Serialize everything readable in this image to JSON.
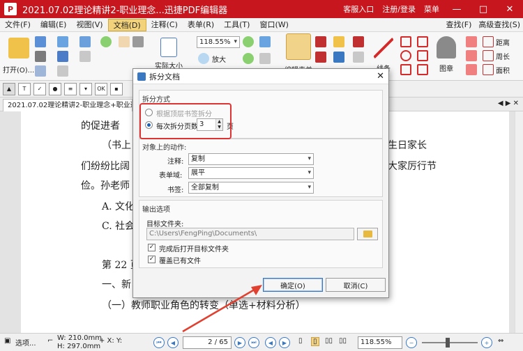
{
  "window": {
    "title": "2021.07.02理论精讲2-职业理念...迅捷PDF编辑器",
    "app_icon": "P",
    "right_items": [
      "客服入口",
      "注册/登录",
      "菜单"
    ],
    "controls": [
      "—",
      "□",
      "✕"
    ]
  },
  "menu": {
    "items": [
      "文件(F)",
      "编辑(E)",
      "视图(V)",
      "文档(D)",
      "注释(C)",
      "表单(R)",
      "工具(T)",
      "窗口(W)"
    ],
    "active_index": 3,
    "right": [
      "查找(F)",
      "高级查找(S)"
    ]
  },
  "ribbon": {
    "open_label": "打开(O)...",
    "zoom_value": "118.55%",
    "zoom_in_label": "放大",
    "actual_size_label": "实际大小",
    "edit_form_label": "编辑表单",
    "line_label": "线条",
    "stamp_label": "图章",
    "measure": [
      "距离",
      "周长",
      "面积"
    ]
  },
  "tab": {
    "title": "2021.07.02理论精讲2-职业理念+职业道德知..."
  },
  "document": {
    "lines": [
      "的促进者",
      "（书上",
      "生日家长",
      "们纷纷比阔",
      "大家厉行节",
      "俭。孙老师",
      "A. 文化",
      "C. 社会",
      "第 22 页",
      "一、新",
      "（一）教师职业角色的转变（单选+材料分析）"
    ]
  },
  "dialog": {
    "title": "拆分文档",
    "section_split": "拆分方式",
    "option_bookmark": "根据顶层书签拆分",
    "option_pages": "每次拆分页数",
    "pages_value": "3",
    "pages_unit": "页",
    "section_actions": "对象上的动作:",
    "annotation_label": "注释:",
    "annotation_value": "复制",
    "formfield_label": "表单域:",
    "formfield_value": "展平",
    "bookmark_label": "书签:",
    "bookmark_value": "全部复制",
    "section_output": "输出选项",
    "target_folder_label": "目标文件夹:",
    "target_folder_value": "C:\\Users\\FengPing\\Documents\\",
    "check_open": "完成后打开目标文件夹",
    "check_overwrite": "覆盖已有文件",
    "ok": "确定(O)",
    "cancel": "取消(C)"
  },
  "status": {
    "options": "选项...",
    "width": "W: 210.0mm",
    "height": "H: 297.0mm",
    "page_current": "2",
    "page_total": "/ 65",
    "zoom": "118.55%"
  }
}
